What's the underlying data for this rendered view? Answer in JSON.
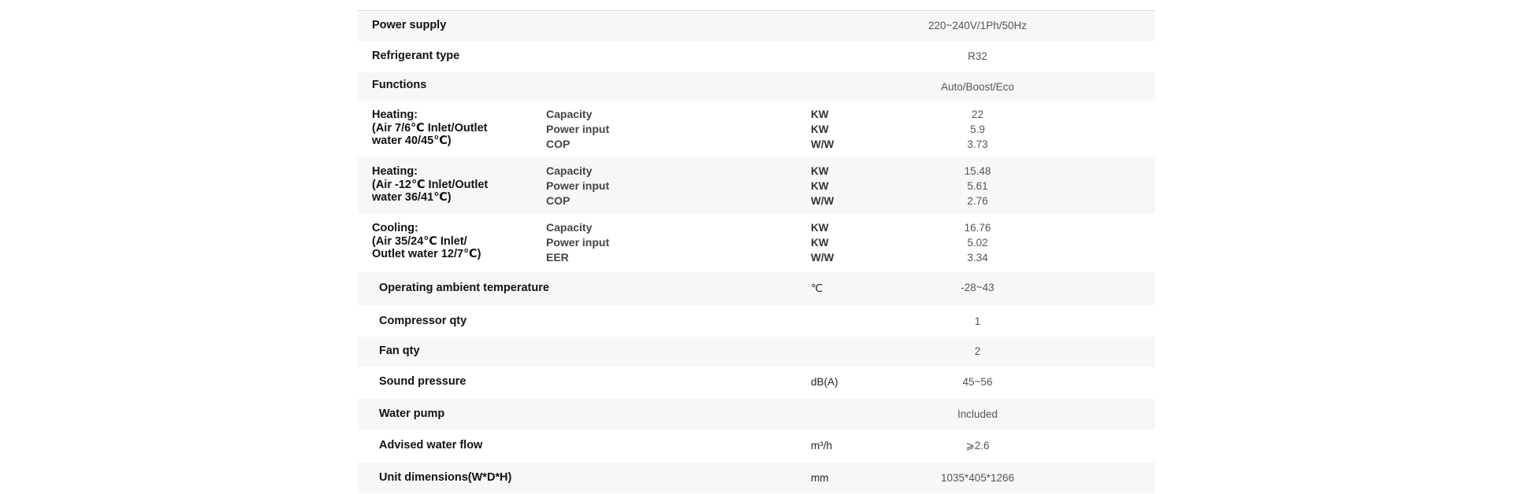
{
  "rows": [
    {
      "label": "Power supply",
      "unit": "",
      "value": "220~240V/1Ph/50Hz"
    },
    {
      "label": "Refrigerant type",
      "unit": "",
      "value": "R32"
    },
    {
      "label": "Functions",
      "unit": "",
      "value": "Auto/Boost/Eco"
    }
  ],
  "groups": [
    {
      "title": [
        "Heating:",
        "(Air 7/6℃ Inlet/Outlet",
        "water 40/45℃)"
      ],
      "items": [
        {
          "name": "Capacity",
          "unit": "KW",
          "value": "22"
        },
        {
          "name": "Power input",
          "unit": "KW",
          "value": "5.9"
        },
        {
          "name": "COP",
          "unit": "W/W",
          "value": "3.73"
        }
      ]
    },
    {
      "title": [
        "Heating:",
        "(Air -12℃ Inlet/Outlet",
        "water 36/41℃)"
      ],
      "items": [
        {
          "name": "Capacity",
          "unit": "KW",
          "value": "15.48"
        },
        {
          "name": "Power input",
          "unit": "KW",
          "value": "5.61"
        },
        {
          "name": "COP",
          "unit": "W/W",
          "value": "2.76"
        }
      ]
    },
    {
      "title": [
        "Cooling:",
        "(Air 35/24℃ Inlet/",
        "Outlet water 12/7℃)"
      ],
      "items": [
        {
          "name": "Capacity",
          "unit": "KW",
          "value": "16.76"
        },
        {
          "name": "Power input",
          "unit": "KW",
          "value": "5.02"
        },
        {
          "name": "EER",
          "unit": "W/W",
          "value": "3.34"
        }
      ]
    }
  ],
  "rows2": [
    {
      "label": "Operating ambient temperature",
      "unit": "℃",
      "value": "-28~43"
    },
    {
      "label": "Compressor qty",
      "unit": "",
      "value": "1"
    },
    {
      "label": "Fan qty",
      "unit": "",
      "value": "2"
    },
    {
      "label": "Sound pressure",
      "unit": "dB(A)",
      "value": "45~56"
    },
    {
      "label": "Water pump",
      "unit": "",
      "value": "Included"
    },
    {
      "label": "Advised water flow",
      "unit": "m³/h",
      "value": "⩾2.6"
    },
    {
      "label": "Unit dimensions(W*D*H)",
      "unit": "mm",
      "value": "1035*405*1266"
    }
  ]
}
